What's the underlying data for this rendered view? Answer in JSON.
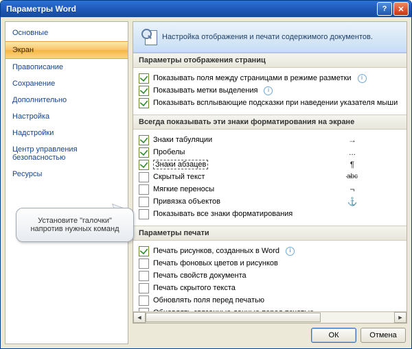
{
  "window": {
    "title": "Параметры Word"
  },
  "sidebar": {
    "items": [
      {
        "label": "Основные"
      },
      {
        "label": "Экран",
        "selected": true
      },
      {
        "label": "Правописание"
      },
      {
        "label": "Сохранение"
      },
      {
        "label": "Дополнительно"
      },
      {
        "label": "Настройка"
      },
      {
        "label": "Надстройки"
      },
      {
        "label": "Центр управления безопасностью"
      },
      {
        "label": "Ресурсы"
      }
    ]
  },
  "header": {
    "title": "Настройка отображения и печати содержимого документов."
  },
  "sections": {
    "display": {
      "title": "Параметры отображения страниц",
      "opts": [
        {
          "label": "Показывать поля между страницами в режиме разметки",
          "checked": true,
          "info": true
        },
        {
          "label": "Показывать метки выделения",
          "checked": true,
          "info": true
        },
        {
          "label": "Показывать всплывающие подсказки при наведении указателя мыши",
          "checked": true
        }
      ]
    },
    "marks": {
      "title": "Всегда показывать эти знаки форматирования на экране",
      "opts": [
        {
          "label": "Знаки табуляции",
          "checked": true,
          "sym": "→"
        },
        {
          "label": "Пробелы",
          "checked": true,
          "sym": "..."
        },
        {
          "label": "Знаки абзацев",
          "checked": true,
          "sym": "¶",
          "boxed": true
        },
        {
          "label": "Скрытый текст",
          "checked": false,
          "sym": "abc",
          "strike": true
        },
        {
          "label": "Мягкие переносы",
          "checked": false,
          "sym": "¬"
        },
        {
          "label": "Привязка объектов",
          "checked": false,
          "sym": "⚓"
        },
        {
          "label": "Показывать все знаки форматирования",
          "checked": false
        }
      ]
    },
    "print": {
      "title": "Параметры печати",
      "opts": [
        {
          "label": "Печать рисунков, созданных в Word",
          "checked": true,
          "info": true
        },
        {
          "label": "Печать фоновых цветов и рисунков",
          "checked": false
        },
        {
          "label": "Печать свойств документа",
          "checked": false
        },
        {
          "label": "Печать скрытого текста",
          "checked": false
        },
        {
          "label": "Обновлять поля перед печатью",
          "checked": false
        },
        {
          "label": "Обновлять связанные данные перед печатью",
          "checked": false
        }
      ]
    }
  },
  "callout": {
    "text": "Установите \"галочки\" напротив нужных команд"
  },
  "buttons": {
    "ok": "ОК",
    "cancel": "Отмена"
  }
}
